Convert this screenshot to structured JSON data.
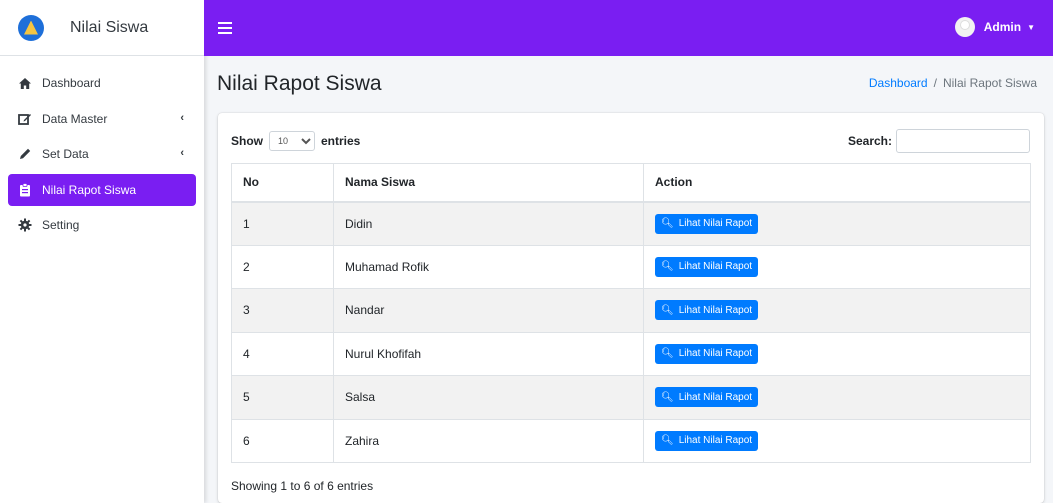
{
  "brand": {
    "name": "Nilai Siswa",
    "logo_icon": "tut-wuri-handayani-logo"
  },
  "sidebar": {
    "items": [
      {
        "label": "Dashboard",
        "icon": "home-icon",
        "active": false,
        "has_chevron": false
      },
      {
        "label": "Data Master",
        "icon": "edit-icon",
        "active": false,
        "has_chevron": true
      },
      {
        "label": "Set Data",
        "icon": "pencil-icon",
        "active": false,
        "has_chevron": true
      },
      {
        "label": "Nilai Rapot Siswa",
        "icon": "clipboard-icon",
        "active": true,
        "has_chevron": false
      },
      {
        "label": "Setting",
        "icon": "gear-icon",
        "active": false,
        "has_chevron": false
      }
    ]
  },
  "topbar": {
    "user_name": "Admin",
    "accent_color": "#7a1ef2"
  },
  "header": {
    "title": "Nilai Rapot Siswa",
    "breadcrumb": {
      "home": "Dashboard",
      "separator": "/",
      "current": "Nilai Rapot Siswa"
    }
  },
  "table_controls": {
    "show_label": "Show",
    "entries_label": "entries",
    "page_size": "10",
    "search_label": "Search:",
    "search_value": ""
  },
  "table": {
    "columns": [
      "No",
      "Nama Siswa",
      "Action"
    ],
    "action_label": "Lihat Nilai Rapot",
    "rows": [
      {
        "no": "1",
        "nama": "Didin"
      },
      {
        "no": "2",
        "nama": "Muhamad Rofik"
      },
      {
        "no": "3",
        "nama": "Nandar"
      },
      {
        "no": "4",
        "nama": "Nurul Khofifah"
      },
      {
        "no": "5",
        "nama": "Salsa"
      },
      {
        "no": "6",
        "nama": "Zahira"
      }
    ]
  },
  "footer_info": "Showing 1 to 6 of 6 entries"
}
